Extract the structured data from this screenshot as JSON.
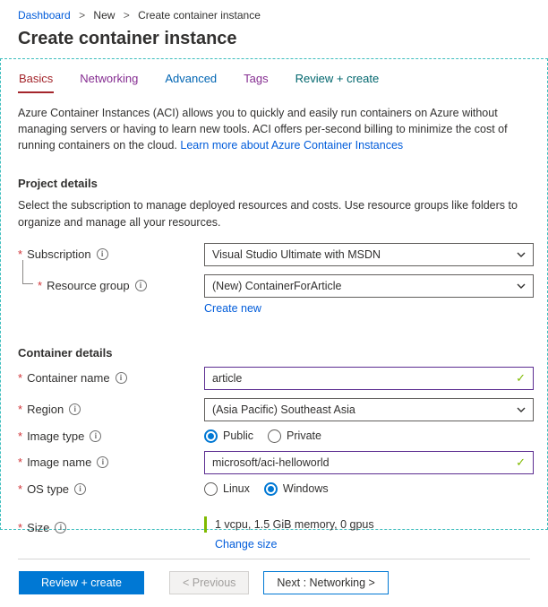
{
  "ui": {
    "required_marker": "*",
    "info_glyph": "i",
    "check_glyph": "✓",
    "breadcrumb_separator": ">"
  },
  "breadcrumb": {
    "items": [
      {
        "label": "Dashboard"
      },
      {
        "label": "New"
      },
      {
        "label": "Create container instance"
      }
    ]
  },
  "page": {
    "title": "Create container instance"
  },
  "tabs": [
    {
      "label": "Basics",
      "color": "#a4262c",
      "active": true
    },
    {
      "label": "Networking",
      "color": "#852d91",
      "active": false
    },
    {
      "label": "Advanced",
      "color": "#0065b3",
      "active": false
    },
    {
      "label": "Tags",
      "color": "#852d91",
      "active": false
    },
    {
      "label": "Review + create",
      "color": "#00666d",
      "active": false
    }
  ],
  "intro": {
    "text": "Azure Container Instances (ACI) allows you to quickly and easily run containers on Azure without managing servers or having to learn new tools. ACI offers per-second billing to minimize the cost of running containers on the cloud.",
    "link": "Learn more about Azure Container Instances"
  },
  "project": {
    "heading": "Project details",
    "description": "Select the subscription to manage deployed resources and costs. Use resource groups like folders to organize and manage all your resources.",
    "subscription": {
      "label": "Subscription",
      "value": "Visual Studio Ultimate with MSDN"
    },
    "resource_group": {
      "label": "Resource group",
      "value": "(New) ContainerForArticle",
      "create_new": "Create new"
    }
  },
  "container": {
    "heading": "Container details",
    "name": {
      "label": "Container name",
      "value": "article"
    },
    "region": {
      "label": "Region",
      "value": "(Asia Pacific) Southeast Asia"
    },
    "image_type": {
      "label": "Image type",
      "public": "Public",
      "private": "Private",
      "selected": "Public"
    },
    "image_name": {
      "label": "Image name",
      "value": "microsoft/aci-helloworld"
    },
    "os_type": {
      "label": "OS type",
      "linux": "Linux",
      "windows": "Windows",
      "selected": "Windows"
    },
    "size": {
      "label": "Size",
      "value": "1 vcpu, 1.5 GiB memory, 0 gpus",
      "change_link": "Change size"
    }
  },
  "footer": {
    "review_create": "Review + create",
    "previous": "< Previous",
    "next": "Next : Networking >"
  },
  "colors": {
    "accent": "#0078d4",
    "link": "#015cda",
    "required": "#d13438",
    "valid": "#7fba00",
    "blade_outline": "#3dbdbd",
    "input_border": "#5c2d91"
  }
}
